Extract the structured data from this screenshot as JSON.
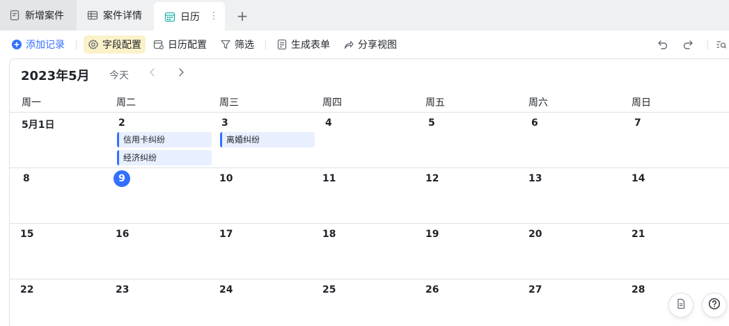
{
  "tabs": [
    {
      "label": "新增案件",
      "icon": "form-icon"
    },
    {
      "label": "案件详情",
      "icon": "grid-table-icon"
    },
    {
      "label": "日历",
      "icon": "calendar-icon",
      "active": true
    }
  ],
  "toolbar": {
    "add_record": "添加记录",
    "field_config": "字段配置",
    "calendar_config": "日历配置",
    "filter": "筛选",
    "generate_form": "生成表单",
    "share_view": "分享视图"
  },
  "calendar": {
    "title": "2023年5月",
    "today_label": "今天",
    "weekdays": [
      "周一",
      "周二",
      "周三",
      "周四",
      "周五",
      "周六",
      "周日"
    ],
    "weeks": [
      [
        "5月1日",
        "2",
        "3",
        "4",
        "5",
        "6",
        "7"
      ],
      [
        "8",
        "9",
        "10",
        "11",
        "12",
        "13",
        "14"
      ],
      [
        "15",
        "16",
        "17",
        "18",
        "19",
        "20",
        "21"
      ],
      [
        "22",
        "23",
        "24",
        "25",
        "26",
        "27",
        "28"
      ]
    ],
    "today": "9",
    "events": {
      "may2": [
        "信用卡纠纷",
        "经济纠纷"
      ],
      "may3": [
        "离婚纠纷"
      ]
    }
  },
  "colors": {
    "accent": "#3370ff",
    "event_bg": "#e8efff",
    "highlight_bg": "#fcf2c9"
  }
}
